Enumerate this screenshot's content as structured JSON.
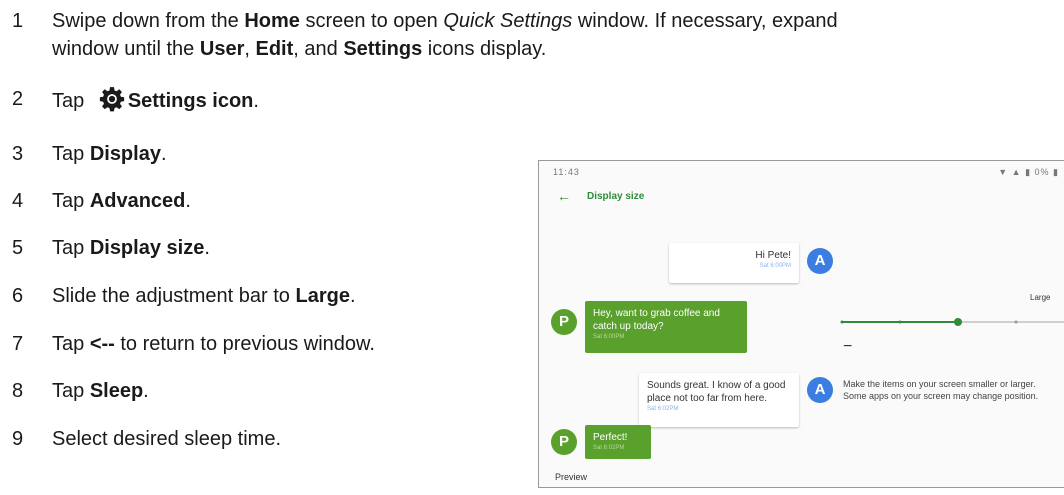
{
  "steps": [
    {
      "n": "1",
      "parts": [
        "Swipe down from the ",
        "Home",
        " screen to open ",
        "Quick Settings",
        " window. If necessary, expand"
      ],
      "line2": [
        "window until the ",
        "User",
        ", ",
        "Edit",
        ", and ",
        "Settings",
        " icons display."
      ]
    },
    {
      "n": "2",
      "parts": [
        "Tap ",
        "Settings icon",
        "."
      ]
    },
    {
      "n": "3",
      "parts": [
        "Tap ",
        "Display",
        "."
      ]
    },
    {
      "n": "4",
      "parts": [
        "Tap ",
        "Advanced",
        "."
      ]
    },
    {
      "n": "5",
      "parts": [
        "Tap ",
        "Display size",
        "."
      ]
    },
    {
      "n": "6",
      "parts": [
        "Slide the adjustment bar to ",
        "Large",
        "."
      ]
    },
    {
      "n": "7",
      "parts": [
        "Tap ",
        "<--",
        " to return to previous window."
      ]
    },
    {
      "n": "8",
      "parts": [
        "Tap ",
        "Sleep",
        "."
      ]
    },
    {
      "n": "9",
      "parts": [
        "Select desired sleep time."
      ]
    }
  ],
  "device": {
    "status_time": "11:43",
    "status_right": "▼ ▲ ▮ 0% ▮",
    "back_glyph": "←",
    "title": "Display size",
    "messages": [
      {
        "text": "Hi Pete!",
        "time": "Sat 6:00PM",
        "avatar": "A"
      },
      {
        "text": "Hey, want to grab coffee and catch up today?",
        "time": "Sat 6:00PM",
        "avatar": "P"
      },
      {
        "text": "Sounds great. I know of a good place not too far from here.",
        "time": "Sat 6:02PM",
        "avatar": "A"
      },
      {
        "text": "Perfect!",
        "time": "Sat 6:02PM",
        "avatar": "P"
      }
    ],
    "preview_label": "Preview",
    "size_label": "Large",
    "minus": "−",
    "plus": "+",
    "desc_line1": "Make the items on your screen smaller or larger.",
    "desc_line2": "Some apps on your screen may change position.",
    "slider": {
      "levels": 5,
      "selected_index": 2
    }
  }
}
